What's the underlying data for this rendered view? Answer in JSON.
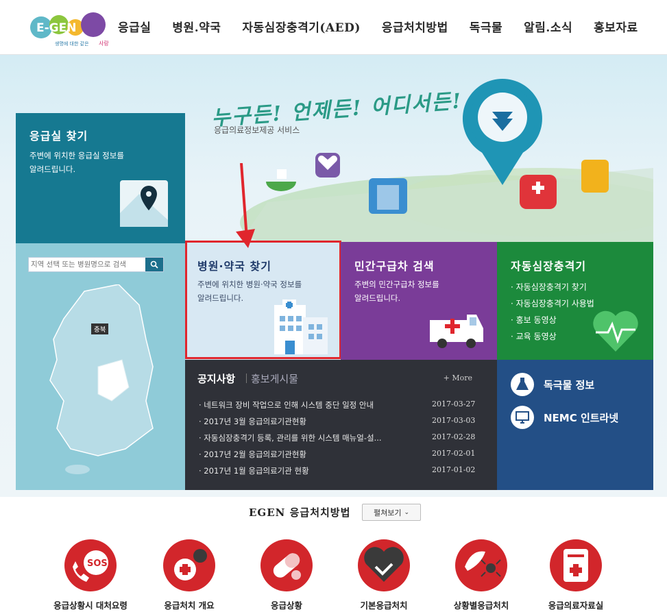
{
  "logo": {
    "text": "E-GEN",
    "tagline_a": "생명에 대한 같은",
    "tagline_b": "사랑"
  },
  "nav": [
    "응급실",
    "병원.약국",
    "자동심장충격기(AED)",
    "응급처치방법",
    "독극물",
    "알림.소식",
    "홍보자료"
  ],
  "hero": {
    "slogan": "누구든! 언제든! 어디서든!",
    "subtitle": "응급의료정보제공 서비스"
  },
  "er_panel": {
    "title": "응급실 찾기",
    "desc": "주변에 위치한 응급실 정보를\n알려드립니다."
  },
  "search": {
    "placeholder": "지역 선택 또는 병원명으로 검색"
  },
  "map": {
    "region_label": "충북"
  },
  "hospital_panel": {
    "title": "병원·약국 찾기",
    "desc": "주변에 위치한 병원·약국 정보를\n알려드립니다."
  },
  "ambulance_panel": {
    "title": "민간구급차 검색",
    "desc": "주변의 민간구급차 정보를\n알려드립니다."
  },
  "aed_panel": {
    "title": "자동심장충격기",
    "items": [
      "· 자동심장충격기 찾기",
      "· 자동심장충격기 사용법",
      "· 홍보 동영상",
      "· 교육 동영상"
    ]
  },
  "notice": {
    "tab_active": "공지사항",
    "tab_inactive": "홍보게시물",
    "more": "+ More",
    "rows": [
      {
        "title": "· 네트워크 장비 작업으로 인해 시스템 중단 일정 안내",
        "date": "2017-03-27"
      },
      {
        "title": "· 2017년 3월 응급의료기관현황",
        "date": "2017-03-03"
      },
      {
        "title": "· 자동심장충격기 등록, 관리를 위한 시스템 매뉴얼-설...",
        "date": "2017-02-28"
      },
      {
        "title": "· 2017년 2월 응급의료기관현황",
        "date": "2017-02-01"
      },
      {
        "title": "· 2017년 1월 응급의료기관 현황",
        "date": "2017-01-02"
      }
    ]
  },
  "links": [
    {
      "label": "독극물 정보",
      "icon": "flask-icon"
    },
    {
      "label": "NEMC 인트라넷",
      "icon": "monitor-icon"
    }
  ],
  "guide": {
    "title": "EGEN 응급처치방법",
    "expand": "펼쳐보기",
    "items": [
      {
        "label": "응급상황시 대처요령",
        "icon": "sos-phone-icon"
      },
      {
        "label": "응급처치 개요",
        "icon": "gear-cross-icon"
      },
      {
        "label": "응급상황",
        "icon": "pill-icon"
      },
      {
        "label": "기본응급처치",
        "icon": "heart-hands-icon"
      },
      {
        "label": "상황별응급처치",
        "icon": "insect-icon"
      },
      {
        "label": "응급의료자료실",
        "icon": "document-icon"
      }
    ]
  },
  "colors": {
    "er": "#167991",
    "hospital": "#d8e8f3",
    "ambulance": "#7a3c98",
    "aed": "#1c8a3c",
    "notice": "#2f3138",
    "links": "#234f86",
    "highlight": "#e0262d",
    "guide_red": "#d2262b"
  }
}
